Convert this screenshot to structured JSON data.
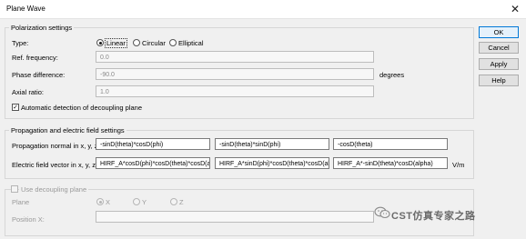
{
  "window": {
    "title": "Plane Wave",
    "close_glyph": "✕"
  },
  "polarization": {
    "group_label": "Polarization settings",
    "type_label": "Type:",
    "options": [
      {
        "label": "Linear",
        "selected": true
      },
      {
        "label": "Circular",
        "selected": false
      },
      {
        "label": "Elliptical",
        "selected": false
      }
    ],
    "ref_frequency": {
      "label": "Ref. frequency:",
      "value": "0.0"
    },
    "phase_difference": {
      "label": "Phase difference:",
      "value": "-90.0",
      "unit": "degrees"
    },
    "axial_ratio": {
      "label": "Axial ratio:",
      "value": "1.0"
    },
    "auto_detect": {
      "label": "Automatic detection of decoupling plane",
      "checked": true
    }
  },
  "propagation": {
    "group_label": "Propagation and electric field settings",
    "normal_label": "Propagation normal in x, y, z:",
    "normal_values": [
      "-sinD(theta)*cosD(phi)",
      "-sinD(theta)*sinD(phi)",
      "-cosD(theta)"
    ],
    "efield_label": "Electric field vector in x, y, z:",
    "efield_values": [
      "HIRF_A*cosD(phi)*cosD(theta)*cosD(alpha)",
      "HIRF_A*sinD(phi)*cosD(theta)*cosD(alpha)",
      "HIRF_A*-sinD(theta)*cosD(alpha)"
    ],
    "efield_unit": "V/m"
  },
  "decoupling": {
    "checkbox_label": "Use decoupling plane",
    "plane_label": "Plane",
    "plane_options": [
      {
        "label": "X",
        "selected": true
      },
      {
        "label": "Y",
        "selected": false
      },
      {
        "label": "Z",
        "selected": false
      }
    ],
    "position_label": "Position X:",
    "position_value": ""
  },
  "buttons": {
    "ok": "OK",
    "cancel": "Cancel",
    "apply": "Apply",
    "help": "Help"
  },
  "watermark": {
    "text": "CST仿真专家之路",
    "icon": "wechat-icon"
  }
}
